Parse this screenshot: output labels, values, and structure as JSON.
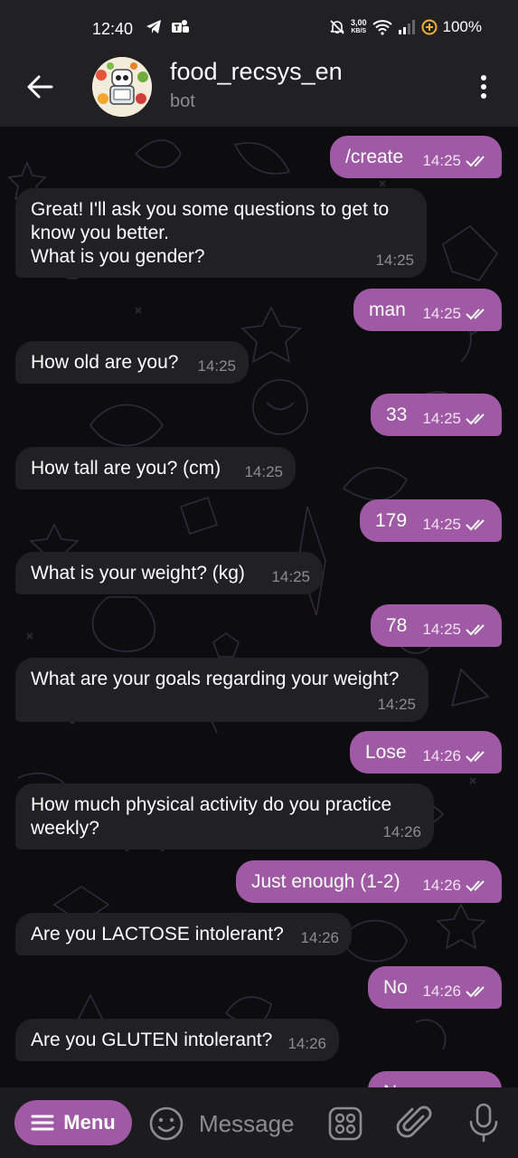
{
  "status_bar": {
    "time": "12:40",
    "net_speed_value": "3,00",
    "net_speed_unit": "KB/S",
    "battery": "100%",
    "icons": [
      "telegram-icon",
      "teams-icon",
      "mute-icon",
      "wifi-icon",
      "signal-icon",
      "battery-saver-icon"
    ]
  },
  "header": {
    "title": "food_recsys_en",
    "subtitle": "bot"
  },
  "messages": [
    {
      "dir": "out",
      "text": "/create",
      "time": "14:25"
    },
    {
      "dir": "in",
      "text": "Great! I'll ask you some questions to get to\nknow you better.\nWhat is you gender?",
      "time": "14:25"
    },
    {
      "dir": "out",
      "text": "man",
      "time": "14:25"
    },
    {
      "dir": "in",
      "text": "How old are you?",
      "time": "14:25"
    },
    {
      "dir": "out",
      "text": "33",
      "time": "14:25"
    },
    {
      "dir": "in",
      "text": "How tall are you? (cm)",
      "time": "14:25"
    },
    {
      "dir": "out",
      "text": "179",
      "time": "14:25"
    },
    {
      "dir": "in",
      "text": "What is your weight? (kg)",
      "time": "14:25"
    },
    {
      "dir": "out",
      "text": "78",
      "time": "14:25"
    },
    {
      "dir": "in",
      "text": "What are your goals regarding your weight?",
      "time": "14:25"
    },
    {
      "dir": "out",
      "text": "Lose",
      "time": "14:26"
    },
    {
      "dir": "in",
      "text": "How much physical activity do you practice\nweekly?",
      "time": "14:26"
    },
    {
      "dir": "out",
      "text": "Just enough (1-2)",
      "time": "14:26"
    },
    {
      "dir": "in",
      "text": "Are you LACTOSE intolerant?",
      "time": "14:26"
    },
    {
      "dir": "out",
      "text": "No",
      "time": "14:26"
    },
    {
      "dir": "in",
      "text": "Are you GLUTEN intolerant?",
      "time": "14:26"
    },
    {
      "dir": "out",
      "text": "No",
      "time": ""
    }
  ],
  "input_bar": {
    "menu_label": "Menu",
    "placeholder": "Message"
  },
  "colors": {
    "accent": "#a05aa5",
    "incoming_bubble": "#212124",
    "background": "#0d0d10"
  }
}
